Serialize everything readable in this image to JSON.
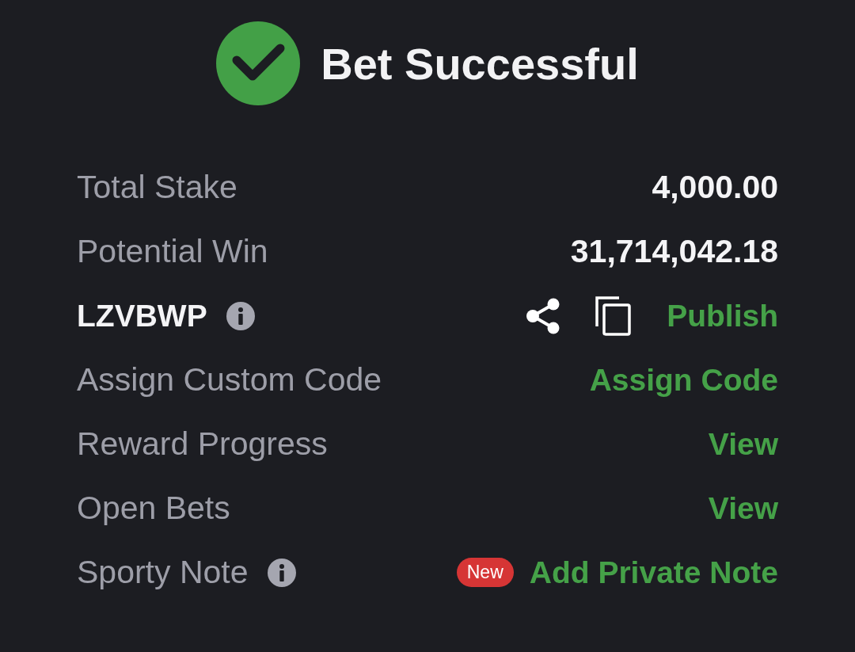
{
  "header": {
    "title": "Bet Successful"
  },
  "rows": [
    {
      "kind": "value",
      "label": "Total Stake",
      "value": "4,000.00"
    },
    {
      "kind": "value",
      "label": "Potential Win",
      "value": "31,714,042.18"
    },
    {
      "kind": "code",
      "label": "LZVBWP",
      "info": true,
      "action": "Publish"
    },
    {
      "kind": "action",
      "label": "Assign Custom Code",
      "action": "Assign Code"
    },
    {
      "kind": "action",
      "label": "Reward Progress",
      "action": "View"
    },
    {
      "kind": "action",
      "label": "Open Bets",
      "action": "View"
    },
    {
      "kind": "note",
      "label": "Sporty Note",
      "info": true,
      "badge": "New",
      "action": "Add Private Note"
    }
  ]
}
